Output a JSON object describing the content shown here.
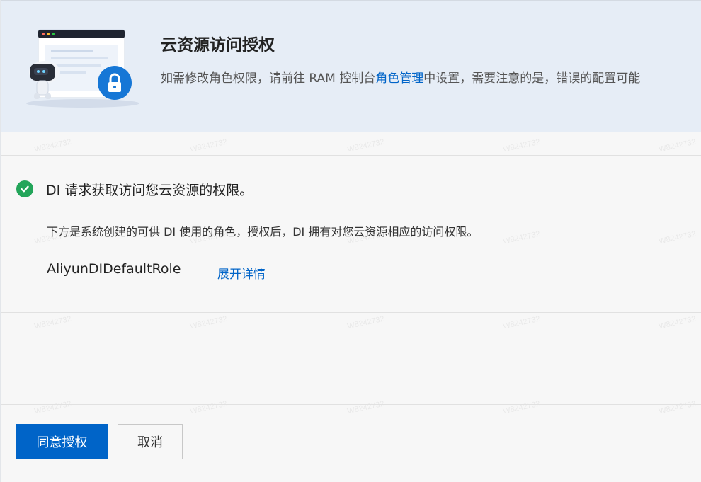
{
  "banner": {
    "title": "云资源访问授权",
    "desc_prefix": "如需修改角色权限，请前往 RAM 控制台",
    "desc_link": "角色管理",
    "desc_suffix": "中设置，需要注意的是，错误的配置可能"
  },
  "status": {
    "icon": "check-circle-icon",
    "text": "DI 请求获取访问您云资源的权限。"
  },
  "description": "下方是系统创建的可供 DI 使用的角色，授权后，DI 拥有对您云资源相应的访问权限。",
  "role": {
    "name": "AliyunDIDefaultRole",
    "expand_label": "展开详情"
  },
  "actions": {
    "agree_label": "同意授权",
    "cancel_label": "取消"
  },
  "watermark": "W8242732",
  "colors": {
    "primary": "#0064c8",
    "success": "#23a55a",
    "banner_bg": "#e6edf6"
  }
}
